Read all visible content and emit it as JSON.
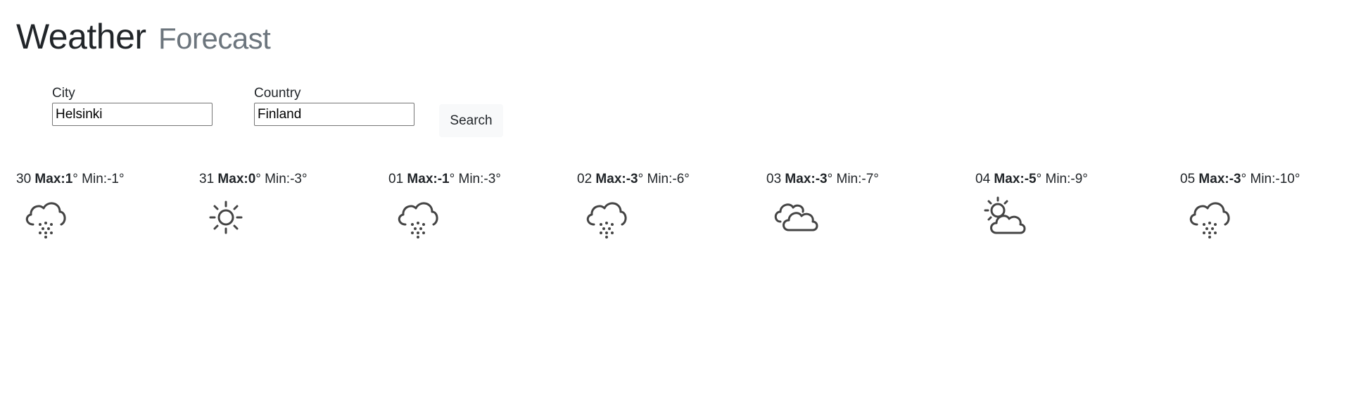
{
  "header": {
    "title": "Weather",
    "subtitle": "Forecast"
  },
  "form": {
    "city_label": "City",
    "city_value": "Helsinki",
    "country_label": "Country",
    "country_value": "Finland",
    "search_label": "Search"
  },
  "forecast": [
    {
      "date": "30",
      "max": "Max:1",
      "deg": "°",
      "min": "Min:-1°",
      "icon": "snow-icon"
    },
    {
      "date": "31",
      "max": "Max:0",
      "deg": "°",
      "min": "Min:-3°",
      "icon": "sun-icon"
    },
    {
      "date": "01",
      "max": "Max:-1",
      "deg": "°",
      "min": "Min:-3°",
      "icon": "snow-icon"
    },
    {
      "date": "02",
      "max": "Max:-3",
      "deg": "°",
      "min": "Min:-6°",
      "icon": "snow-icon"
    },
    {
      "date": "03",
      "max": "Max:-3",
      "deg": "°",
      "min": "Min:-7°",
      "icon": "cloudy-icon"
    },
    {
      "date": "04",
      "max": "Max:-5",
      "deg": "°",
      "min": "Min:-9°",
      "icon": "partly-cloudy-icon"
    },
    {
      "date": "05",
      "max": "Max:-3",
      "deg": "°",
      "min": "Min:-10°",
      "icon": "snow-icon"
    }
  ]
}
